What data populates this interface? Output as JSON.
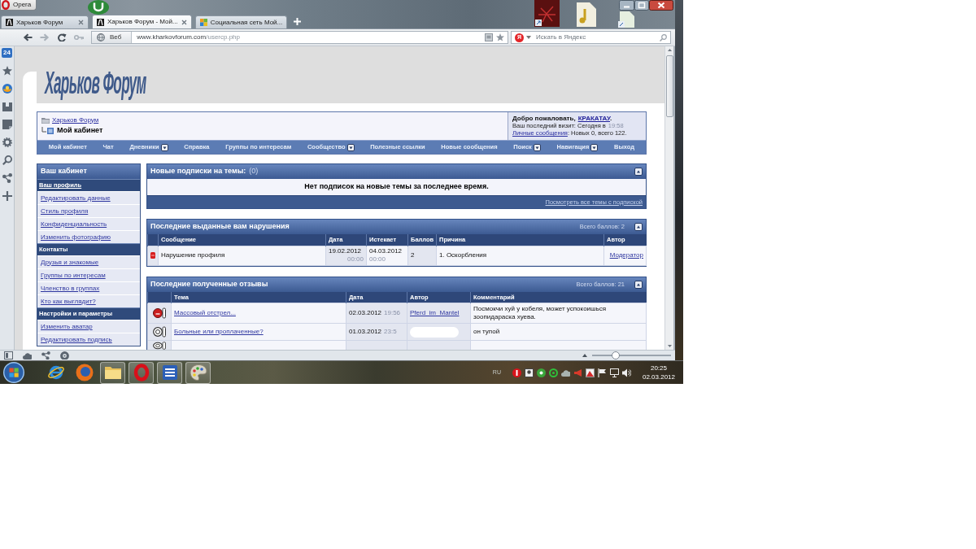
{
  "desktop": {
    "icons": [
      {
        "kind": "app"
      },
      {
        "kind": "disc"
      },
      {
        "kind": "music"
      },
      {
        "kind": "document"
      }
    ]
  },
  "browser": {
    "menu_button": "Opera",
    "tabs": [
      {
        "title": "Харьков Форум",
        "kind": "forum",
        "selected": false,
        "close_shown": true
      },
      {
        "title": "Харьков Форум - Мой...",
        "kind": "forum",
        "selected": true,
        "close_shown": true
      },
      {
        "title": "Социальная сеть Мой...",
        "kind": "social",
        "selected": false,
        "close_shown": false
      }
    ],
    "nav_buttons": [
      {
        "kind": "back",
        "disabled": false
      },
      {
        "kind": "forward",
        "disabled": true
      },
      {
        "kind": "reload",
        "disabled": false
      },
      {
        "kind": "key",
        "disabled": true
      }
    ],
    "address": {
      "site_button": "Веб",
      "host": "www.kharkovforum.com",
      "path": "/usercp.php"
    },
    "search": {
      "engine_mark": "Я",
      "placeholder": "Искать в Яндекс"
    },
    "panel": {
      "counter": "24",
      "buttons": [
        {
          "kind": "star"
        },
        {
          "kind": "globe"
        },
        {
          "kind": "inbox"
        },
        {
          "kind": "note"
        },
        {
          "kind": "gear"
        },
        {
          "kind": "search"
        },
        {
          "kind": "share"
        },
        {
          "kind": "plus"
        }
      ]
    },
    "status_bar": {
      "buttons": [
        {
          "kind": "panel"
        },
        {
          "kind": "cloud"
        },
        {
          "kind": "share"
        },
        {
          "kind": "disc"
        }
      ],
      "zoom": {
        "level": 0.28
      }
    }
  },
  "page": {
    "logo": "Харьков Форум",
    "breadcrumb": {
      "parent": "Харьков Форум",
      "current": "Мой кабинет"
    },
    "welcome": {
      "greeting": "Добро пожаловать,",
      "username": "КРАКАТАУ",
      "greeting_end": ".",
      "last_visit": "Ваш последний визит: Сегодня в",
      "last_visit_time": "19:58",
      "messages_link": "Личные сообщения",
      "messages_info": ": Новых 0, всего 122."
    },
    "nav": [
      {
        "label": "Мой кабинет",
        "has_menu": false
      },
      {
        "label": "Чат",
        "has_menu": false
      },
      {
        "label": "Дневники",
        "has_menu": true
      },
      {
        "label": "Справка",
        "has_menu": false
      },
      {
        "label": "Группы по интересам",
        "has_menu": false
      },
      {
        "label": "Сообщество",
        "has_menu": true
      },
      {
        "label": "Полезные ссылки",
        "has_menu": false
      },
      {
        "label": "Новые сообщения",
        "has_menu": false
      },
      {
        "label": "Поиск",
        "has_menu": true
      },
      {
        "label": "Навигация",
        "has_menu": true
      },
      {
        "label": "Выход",
        "has_menu": false
      }
    ],
    "sidebar": {
      "title": "Ваш кабинет",
      "groups": [
        {
          "title": "Ваш профиль",
          "linked": true,
          "links": [
            "Редактировать данные",
            "Стиль профиля",
            "Конфиденциальность",
            "Изменить фотографию"
          ]
        },
        {
          "title": "Контакты",
          "linked": false,
          "links": [
            "Друзья и знакомые",
            "Группы по интересам",
            "Членство в группах",
            "Кто как выглядит?"
          ]
        },
        {
          "title": "Настройки и параметры",
          "linked": false,
          "links": [
            "Изменить аватар",
            "Редактировать подпись"
          ]
        }
      ]
    },
    "subscriptions": {
      "title": "Новые подписки на темы:",
      "count": "(0)",
      "message": "Нет подписок на новые темы за последнее время.",
      "footer_link": "Посмотреть все темы с подпиской"
    },
    "infractions": {
      "title": "Последние выданные вам нарушения",
      "total": "Всего баллов: 2",
      "columns": [
        "Сообщение",
        "Дата",
        "Истекает",
        "Баллов",
        "Причина",
        "Автор"
      ],
      "rows": [
        {
          "kind": "infraction",
          "message": "Нарушение профиля",
          "date": "19.02.2012",
          "date_time": "00:00",
          "expires": "04.03.2012",
          "expires_time": "00:00",
          "points": "2",
          "reason": "1. Оскорбления",
          "author": "Модератор"
        }
      ]
    },
    "reputation": {
      "title": "Последние полученные отзывы",
      "total": "Всего баллов: 21",
      "columns": [
        "Тема",
        "Дата",
        "Автор",
        "Комментарий"
      ],
      "rows": [
        {
          "kind": "negative",
          "topic": "Массовый отстрел...",
          "date": "02.03.2012",
          "time": "19:56",
          "author": "Pferd_im_Mantel",
          "author_hidden": false,
          "comment": "Посмокчи хуй у кобеля, может успокоишься зоопидараска хуева."
        },
        {
          "kind": "neutral",
          "topic": "Больные или проплаченные?",
          "date": "01.03.2012",
          "time": "23:5",
          "author_hidden": true,
          "comment": "он тупой"
        },
        {
          "kind": "neutral",
          "author_hidden": false
        }
      ]
    }
  },
  "taskbar": {
    "apps": [
      {
        "kind": "ie",
        "running": false
      },
      {
        "kind": "firefox",
        "running": false
      },
      {
        "kind": "explorer",
        "running": true
      },
      {
        "kind": "opera",
        "running": true
      },
      {
        "kind": "word",
        "running": true
      },
      {
        "kind": "paint",
        "running": true
      }
    ],
    "language": "RU",
    "tray_icons": [
      {
        "kind": "red-disc"
      },
      {
        "kind": "portrait"
      },
      {
        "kind": "green-disc"
      },
      {
        "kind": "at"
      },
      {
        "kind": "cloud"
      },
      {
        "kind": "megaphone"
      },
      {
        "kind": "image"
      },
      {
        "kind": "flag"
      },
      {
        "kind": "monitor"
      },
      {
        "kind": "volume"
      }
    ],
    "time": "20:25",
    "date": "02.03.2012"
  }
}
